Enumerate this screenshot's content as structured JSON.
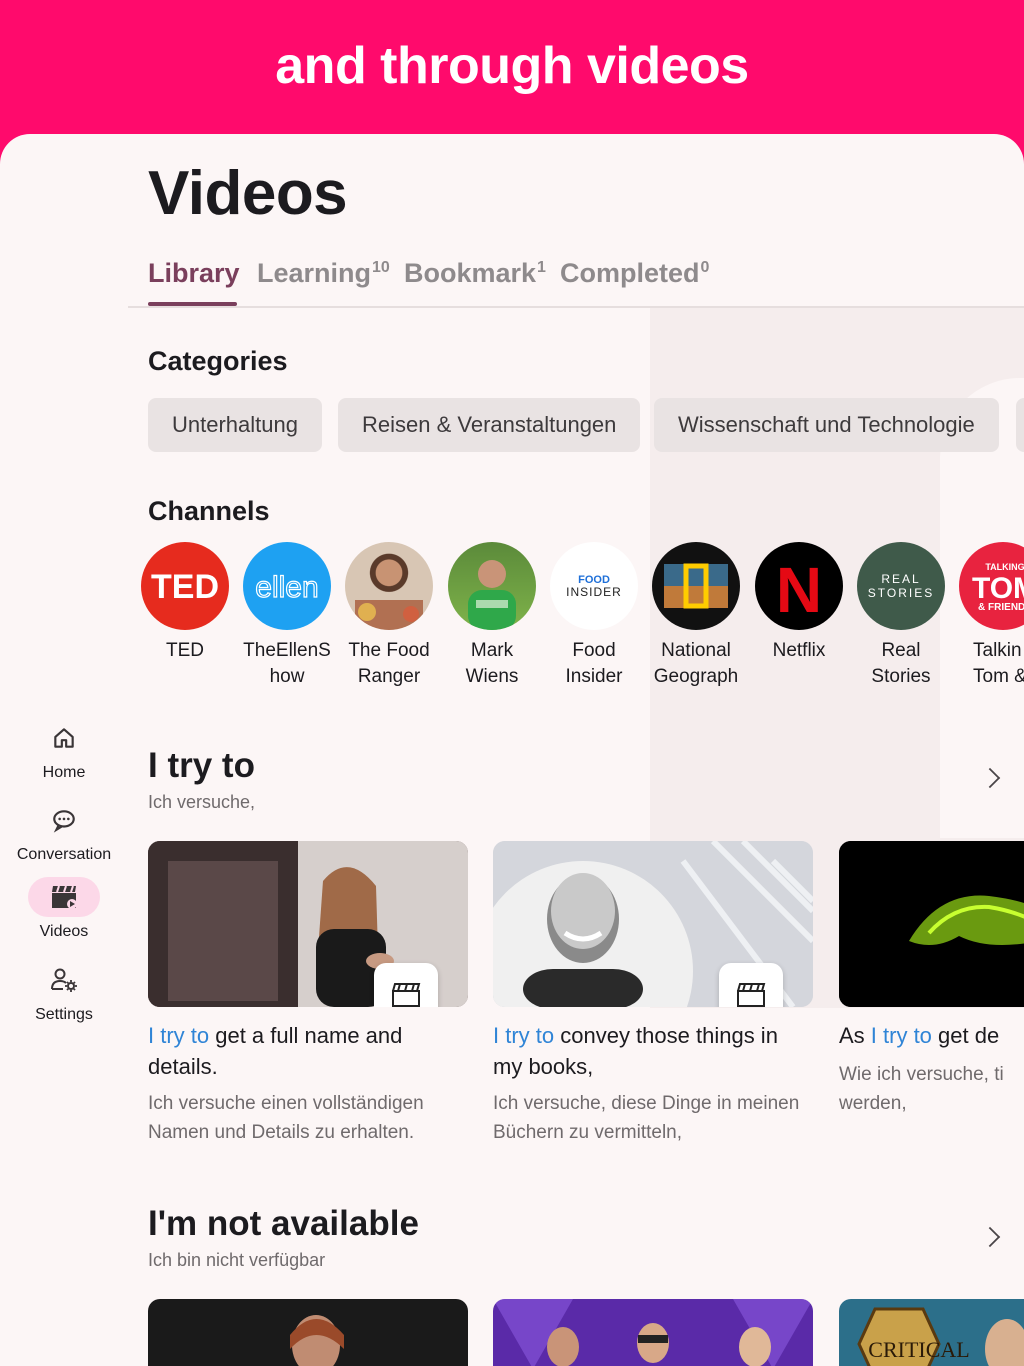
{
  "banner": {
    "text": "and through videos"
  },
  "page": {
    "title": "Videos"
  },
  "tabs": [
    {
      "label": "Library",
      "count": ""
    },
    {
      "label": "Learning",
      "count": "10"
    },
    {
      "label": "Bookmark",
      "count": "1"
    },
    {
      "label": "Completed",
      "count": "0"
    }
  ],
  "categories": {
    "title": "Categories",
    "items": [
      "Unterhaltung",
      "Reisen & Veranstaltungen",
      "Wissenschaft und Technologie"
    ]
  },
  "channels": {
    "title": "Channels",
    "items": [
      {
        "line1": "TED",
        "line2": "",
        "logo": "TED"
      },
      {
        "line1": "TheEllenS",
        "line2": "how",
        "logo": "ellen"
      },
      {
        "line1": "The Food",
        "line2": "Ranger",
        "logo": ""
      },
      {
        "line1": "Mark",
        "line2": "Wiens",
        "logo": ""
      },
      {
        "line1": "Food",
        "line2": "Insider",
        "logo": "FOOD INSIDER"
      },
      {
        "line1": "National",
        "line2": "Geograph",
        "logo": ""
      },
      {
        "line1": "Netflix",
        "line2": "",
        "logo": "N"
      },
      {
        "line1": "Real",
        "line2": "Stories",
        "logo": "REAL STORIES"
      },
      {
        "line1": "Talkin",
        "line2": "Tom &",
        "logo": "TALKING TOM & FRIENDS"
      }
    ]
  },
  "nav": {
    "items": [
      {
        "label": "Home",
        "icon": "home-icon"
      },
      {
        "label": "Conversation",
        "icon": "chat-bubble-icon"
      },
      {
        "label": "Videos",
        "icon": "clapperboard-icon"
      },
      {
        "label": "Settings",
        "icon": "user-settings-icon"
      }
    ]
  },
  "rows": [
    {
      "title": "I try to",
      "subtitle": "Ich versuche,",
      "cards": [
        {
          "hl": "I try to",
          "rest": " get a full name and details.",
          "sub": "Ich versuche einen vollständigen Namen und Details zu erhalten."
        },
        {
          "hl": "I try to",
          "rest": " convey those things in my books,",
          "sub": "Ich versuche, diese Dinge in meinen Büchern zu vermitteln,"
        },
        {
          "pre": "As ",
          "hl": "I try to",
          "rest": " get de",
          "sub": "Wie ich versuche, ti werden,"
        }
      ]
    },
    {
      "title": "I'm not available",
      "subtitle": "Ich bin nicht verfügbar",
      "cards": [
        {
          "logo": ""
        },
        {
          "logo": ""
        },
        {
          "logo": "CRITICAL"
        }
      ]
    }
  ],
  "colors": {
    "brand": "#ff0a6c",
    "tab_active": "#7a3f5c",
    "highlight": "#2f84d6",
    "nav_active": "#fcd8e8"
  }
}
